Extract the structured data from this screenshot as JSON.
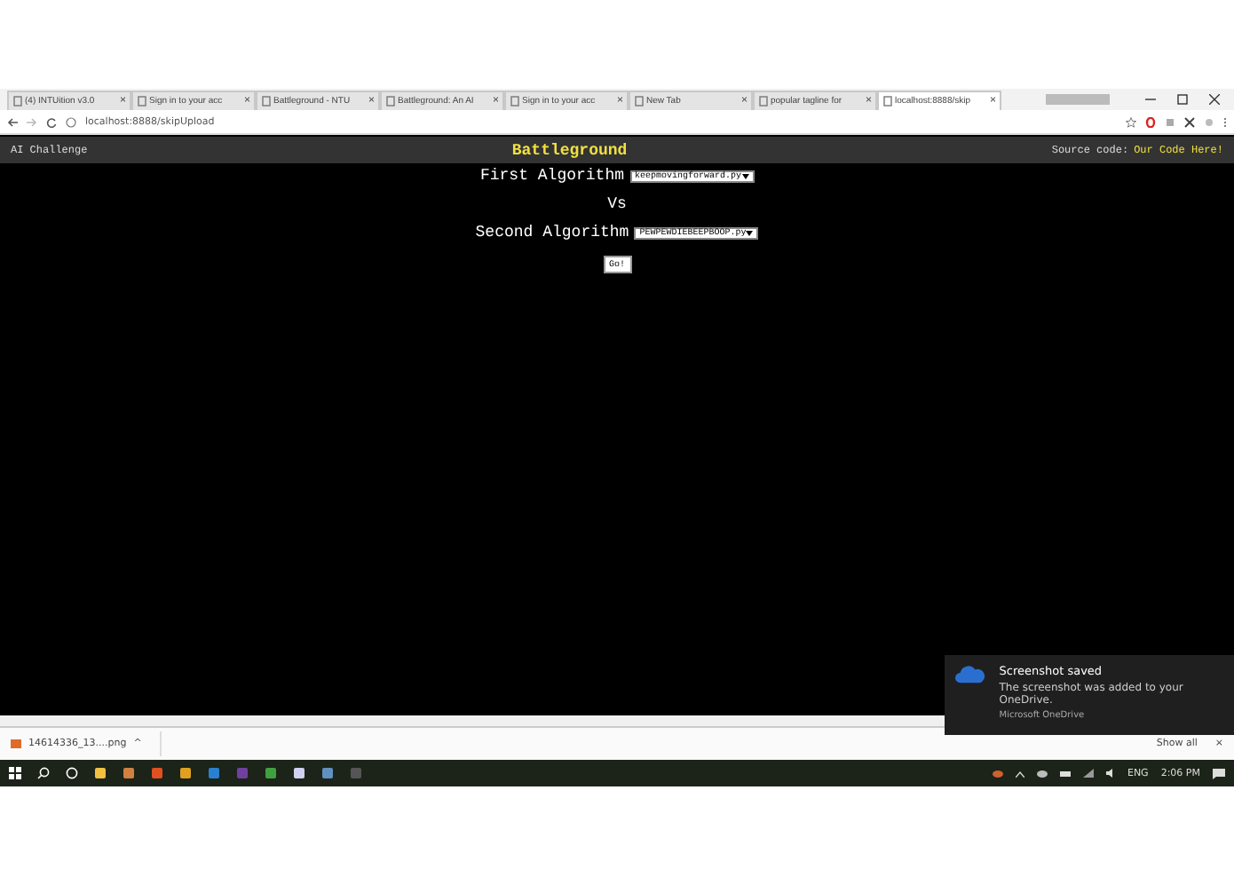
{
  "browser": {
    "tabs": [
      {
        "title": "(4) INTUition v3.0",
        "close": "×",
        "selected": false
      },
      {
        "title": "Sign in to your acc",
        "close": "×",
        "selected": false
      },
      {
        "title": "Battleground - NTU",
        "close": "×",
        "selected": false
      },
      {
        "title": "Battleground: An AI",
        "close": "×",
        "selected": false
      },
      {
        "title": "Sign in to your acc",
        "close": "×",
        "selected": false
      },
      {
        "title": "New Tab",
        "close": "×",
        "selected": false
      },
      {
        "title": "popular tagline for",
        "close": "×",
        "selected": false
      },
      {
        "title": "localhost:8888/skip",
        "close": "×",
        "selected": true
      }
    ],
    "address": "localhost:8888/skipUpload"
  },
  "page": {
    "header": {
      "left": "AI Challenge",
      "title": "Battleground",
      "source_label": "Source code:",
      "source_link": "Our Code Here!"
    },
    "form": {
      "first_label": "First Algorithm",
      "first_value": "keepmovingforward.py",
      "vs": "Vs",
      "second_label": "Second Algorithm",
      "second_value": "PEWPEWDIEBEEPBOOP.py",
      "button": "Go!"
    }
  },
  "download_bar": {
    "file": "14614336_13....png",
    "caret": "^",
    "show_all": "Show all",
    "close": "×"
  },
  "notification": {
    "title": "Screenshot saved",
    "body": "The screenshot was added to your OneDrive.",
    "source": "Microsoft OneDrive"
  },
  "taskbar": {
    "language": "ENG",
    "time": "2:06 PM"
  }
}
